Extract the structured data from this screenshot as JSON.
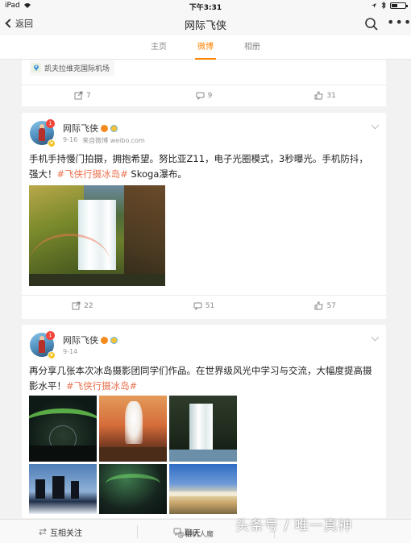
{
  "status_bar": {
    "device": "iPad",
    "time": "下午3:31"
  },
  "nav": {
    "back_label": "返回",
    "title": "网际飞侠"
  },
  "tabs": [
    {
      "label": "主页",
      "active": false
    },
    {
      "label": "微博",
      "active": true
    },
    {
      "label": "相册",
      "active": false
    }
  ],
  "post0": {
    "location": "凯夫拉维克国际机场",
    "reposts": "7",
    "comments": "9",
    "likes": "31"
  },
  "post1": {
    "username": "网际飞侠",
    "notif_count": "1",
    "date": "9-16",
    "source": "来自微博 weibo.com",
    "text_before": "手机手持慢门拍摄，拥抱希望。努比亚Z11，电子光圈模式，3秒曝光。手机防抖，强大！",
    "hashtag": "#飞侠行摄冰岛#",
    "text_after": " Skoga瀑布。",
    "reposts": "22",
    "comments": "51",
    "likes": "57"
  },
  "post2": {
    "username": "网际飞侠",
    "notif_count": "1",
    "date": "9-14",
    "text_before": "再分享几张本次冰岛摄影团同学们作品。在世界级风光中学习与交流，大幅度提高摄影水平！",
    "hashtag": "#飞侠行摄冰岛#"
  },
  "bottom_bar": {
    "follow_label": "互相关注",
    "chat_label": "聊天"
  },
  "watermark": {
    "main": "头条号 / 唯一真神",
    "sub": "@相机人魔"
  },
  "colors": {
    "accent": "#ff8200",
    "hashtag": "#eb7350",
    "background": "#f2f2f2"
  }
}
